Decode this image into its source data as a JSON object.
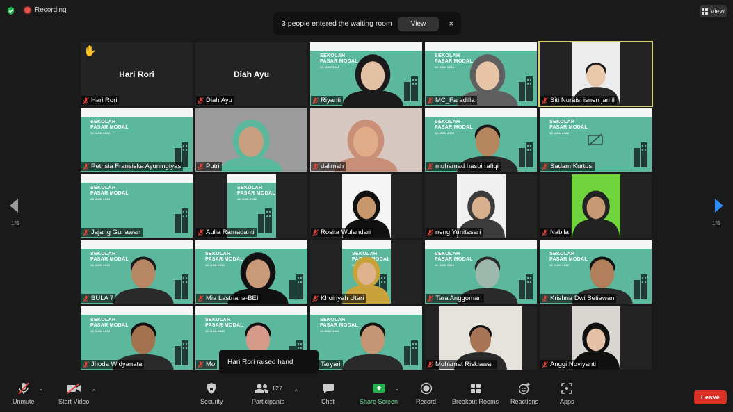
{
  "top": {
    "recording_label": "Recording",
    "notice_text": "3 people entered the waiting room",
    "notice_view": "View",
    "notice_close": "×",
    "view_label": "View"
  },
  "slide_text": {
    "line1": "SEKOLAH",
    "line2": "PASAR MODAL",
    "line3": "16 JUNI 2022"
  },
  "tiles": [
    {
      "name": "Hari Rori",
      "big": "Hari Rori"
    },
    {
      "name": "Diah Ayu",
      "big": "Diah Ayu"
    },
    {
      "name": "Riyanti"
    },
    {
      "name": "MC_Faradilla"
    },
    {
      "name": "Siti Nuraisi isnen jamil"
    },
    {
      "name": "Petrisia Fransiska Ayuningtyas"
    },
    {
      "name": "Putri"
    },
    {
      "name": "dalimah"
    },
    {
      "name": "muhamad hasbi rafiqi"
    },
    {
      "name": "Sadam Kurtusi"
    },
    {
      "name": "Jajang Gunawan"
    },
    {
      "name": "Aulia Ramadanti"
    },
    {
      "name": "Rosita Wulandari"
    },
    {
      "name": "neng Yunitasari"
    },
    {
      "name": "Nabila"
    },
    {
      "name": "BULA 7"
    },
    {
      "name": "Mia Lastriana-BEI"
    },
    {
      "name": "Khoiriyah Utari"
    },
    {
      "name": "Tara Anggoman"
    },
    {
      "name": "Krishna Dwi Setiawan"
    },
    {
      "name": "Jhoda Widyanata"
    },
    {
      "name": "Mo"
    },
    {
      "name": "Taryari"
    },
    {
      "name": "Muhamat Riskiawan"
    },
    {
      "name": "Anggi Noviyanti"
    }
  ],
  "paging": {
    "left": "1/5",
    "right": "1/5"
  },
  "toast": "Hari Rori raised hand",
  "toolbar": {
    "unmute": "Unmute",
    "start_video": "Start Video",
    "security": "Security",
    "participants": "Participants",
    "participants_count": "127",
    "chat": "Chat",
    "share_screen": "Share Screen",
    "record": "Record",
    "breakout_rooms": "Breakout Rooms",
    "reactions": "Reactions",
    "apps": "Apps",
    "leave": "Leave"
  },
  "colors": {
    "share_green": "#22b14c",
    "leave_red": "#d93025",
    "active_border": "#d6d26b",
    "slide_green": "#5bb89c"
  }
}
